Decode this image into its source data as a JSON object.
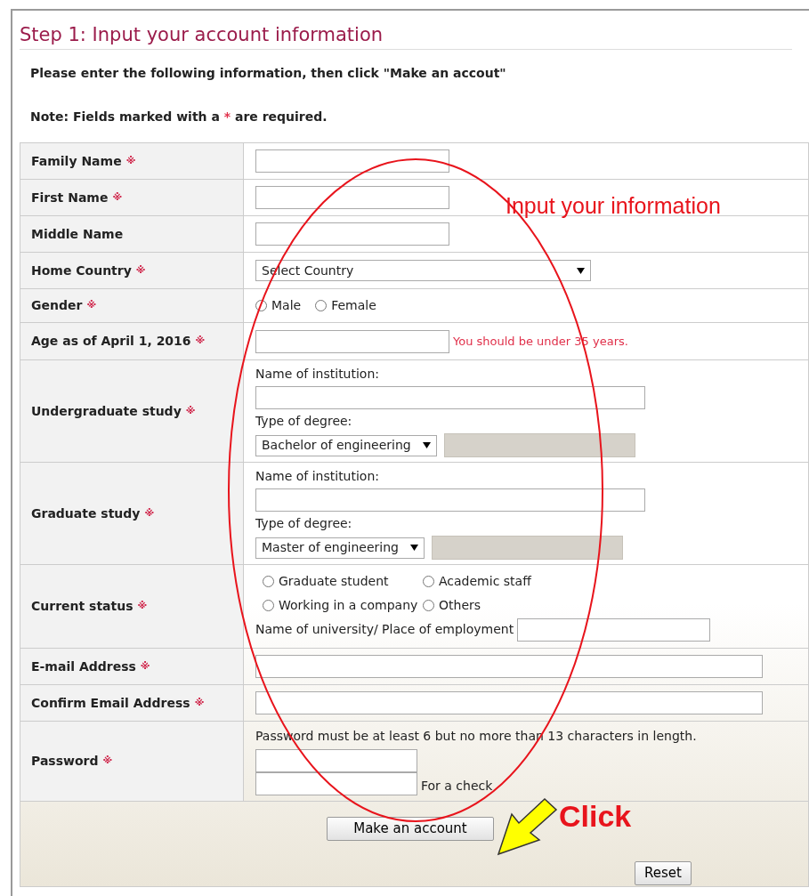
{
  "title": "Step 1: Input your account information",
  "intro": "Please enter the following information, then click \"Make an accout\"",
  "note": {
    "before": "Note: Fields marked with a",
    "mark": "*",
    "after": "are required."
  },
  "rows": [
    {
      "kind": "text",
      "label": "Family Name",
      "mark": "※"
    },
    {
      "kind": "text",
      "label": "First Name",
      "mark": "※"
    },
    {
      "kind": "text",
      "label": "Middle Name"
    },
    {
      "kind": "select",
      "label": "Home Country",
      "mark": "※",
      "value": "Select Country"
    },
    {
      "kind": "radios",
      "label": "Gender",
      "mark": "※",
      "options": [
        {
          "label": "Male",
          "selected": false
        },
        {
          "label": "Female",
          "selected": false
        }
      ]
    },
    {
      "kind": "hint",
      "label": "Age as of April 1, 2016",
      "mark": "※",
      "hint": "You should be under 35 years."
    },
    {
      "kind": "study",
      "label": "Undergraduate study",
      "mark": "※",
      "institution_label": "Name of institution:",
      "degree_label": "Type of degree:",
      "degree": "Bachelor of engineering",
      "other_disabled": true
    },
    {
      "kind": "study",
      "label": "Graduate study",
      "mark": "※",
      "institution_label": "Name of institution:",
      "degree_label": "Type of degree:",
      "degree": "Master of engineering",
      "other_disabled": true
    },
    {
      "kind": "status",
      "label": "Current status",
      "mark": "※",
      "options": [
        {
          "label": "Graduate student",
          "selected": false
        },
        {
          "label": "Academic staff",
          "selected": false
        },
        {
          "label": "Working in a company",
          "selected": false
        },
        {
          "label": "Others",
          "selected": false
        }
      ],
      "place_label": "Name of university/ Place of employment"
    },
    {
      "kind": "wide",
      "label": "E-mail Address",
      "mark": "※"
    },
    {
      "kind": "wide",
      "label": "Confirm Email Address",
      "mark": "※"
    },
    {
      "kind": "password",
      "label": "Password",
      "mark": "※",
      "rule": "Password must be at least 6 but no more than 13 characters in length.",
      "check_label": "For a check"
    }
  ],
  "buttons": [
    {
      "kind": "submit",
      "label": "Make an account"
    },
    {
      "kind": "reset",
      "label": "Reset"
    }
  ],
  "annotations": {
    "callout": "Input your information",
    "click": "Click"
  }
}
